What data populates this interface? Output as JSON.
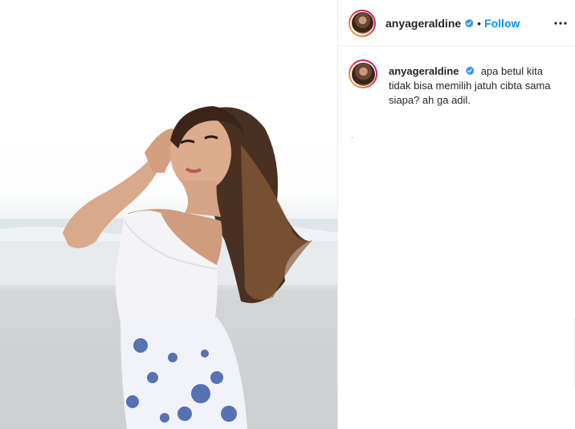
{
  "post": {
    "username": "anyageraldine",
    "separator": "•",
    "follow_label": "Follow",
    "more_icon": "more-horizontal-icon",
    "verified_icon": "verified-badge-icon",
    "accent_color": "#0095f6",
    "verified_color": "#3897f0"
  },
  "caption": {
    "username": "anyageraldine",
    "text": "apa betul kita tidak bisa memilih jatuh cibta sama siapa? ah ga adil."
  },
  "photo": {
    "alt_icon": "post-photo"
  }
}
